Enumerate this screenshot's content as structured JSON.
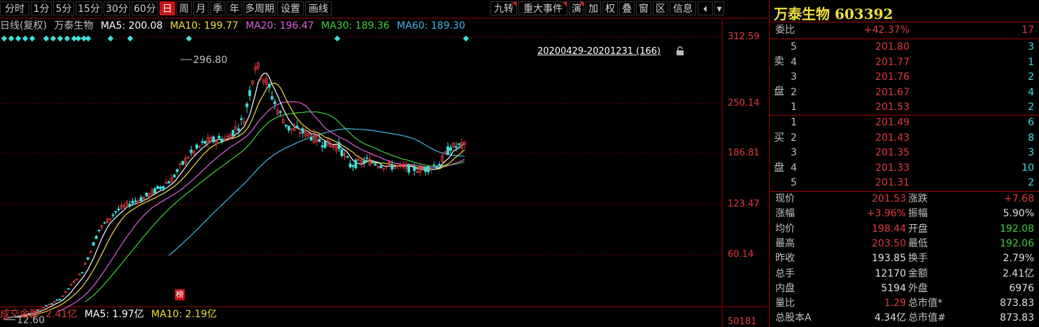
{
  "toolbar": {
    "tabs": [
      "分时",
      "1分",
      "5分",
      "15分",
      "30分",
      "60分",
      "日",
      "周",
      "月",
      "季",
      "年",
      "多周期",
      "设置",
      "画线"
    ],
    "active_tab": "日",
    "right_tabs": [
      "九转",
      "重大事件",
      "演",
      "加",
      "权",
      "叠",
      "窗",
      "区",
      "信息"
    ],
    "right_marked": [
      true,
      true,
      true,
      false,
      false,
      false,
      false,
      false,
      false
    ]
  },
  "chart_legend": {
    "label": "日线(复权)",
    "stock": "万泰生物",
    "ma5": "MA5: 200.08",
    "ma10": "MA10: 199.77",
    "ma20": "MA20: 196.47",
    "ma30": "MA30: 189.36",
    "ma60": "MA60: 189.30"
  },
  "colors": {
    "ma5": "#ffffff",
    "ma10": "#f0e040",
    "ma20": "#e060e0",
    "ma30": "#40d040",
    "ma60": "#40b8e8",
    "up": "#e03a3a",
    "down": "#40e0e0",
    "grid": "#7a0000"
  },
  "price_axis": [
    "312.59",
    "250.14",
    "186.81",
    "123.47",
    "60.14",
    "50181"
  ],
  "range_label": "20200429-20201231 (166)",
  "lock_icon": "lock-icon",
  "annotations": {
    "high": "296.80",
    "low": "12.60",
    "badge": "榜"
  },
  "volume_legend": {
    "amount": "成交金额: 2.41亿",
    "ma5": "MA5: 1.97亿",
    "ma10": "MA10: 2.19亿"
  },
  "chart_data": {
    "type": "candlestick",
    "y_range": [
      48,
      325
    ],
    "y_ticks": [
      312.59,
      250.14,
      186.81,
      123.47,
      60.14
    ],
    "high": 296.8,
    "low": 12.6,
    "grid": true,
    "ma_series": [
      {
        "name": "MA5",
        "value": 200.08
      },
      {
        "name": "MA10",
        "value": 199.77
      },
      {
        "name": "MA20",
        "value": 196.47
      },
      {
        "name": "MA30",
        "value": 189.36
      },
      {
        "name": "MA60",
        "value": 189.3
      }
    ]
  },
  "panel": {
    "title": "万泰生物 603392",
    "weibi": {
      "label": "委比",
      "value": "+42.37%",
      "vol": "17"
    },
    "sell_label": "卖盘",
    "buy_label": "买盘",
    "sell": [
      {
        "level": "5",
        "price": "201.80",
        "vol": "3"
      },
      {
        "level": "4",
        "price": "201.77",
        "vol": "1"
      },
      {
        "level": "3",
        "price": "201.76",
        "vol": "2"
      },
      {
        "level": "2",
        "price": "201.67",
        "vol": "4"
      },
      {
        "level": "1",
        "price": "201.53",
        "vol": "2"
      }
    ],
    "buy": [
      {
        "level": "1",
        "price": "201.49",
        "vol": "6"
      },
      {
        "level": "2",
        "price": "201.43",
        "vol": "8"
      },
      {
        "level": "3",
        "price": "201.35",
        "vol": "3"
      },
      {
        "level": "4",
        "price": "201.33",
        "vol": "10"
      },
      {
        "level": "5",
        "price": "201.31",
        "vol": "2"
      }
    ],
    "quotes": [
      {
        "l1": "现价",
        "v1": "201.53",
        "c1": "red",
        "l2": "涨跌",
        "v2": "+7.68",
        "c2": "red"
      },
      {
        "l1": "涨幅",
        "v1": "+3.96%",
        "c1": "red",
        "l2": "振幅",
        "v2": "5.90%",
        "c2": "white"
      },
      {
        "l1": "均价",
        "v1": "198.44",
        "c1": "red",
        "l2": "开盘",
        "v2": "192.08",
        "c2": "green"
      },
      {
        "l1": "最高",
        "v1": "203.50",
        "c1": "red",
        "l2": "最低",
        "v2": "192.06",
        "c2": "green"
      },
      {
        "l1": "昨收",
        "v1": "193.85",
        "c1": "white",
        "l2": "换手",
        "v2": "2.79%",
        "c2": "white"
      },
      {
        "l1": "总手",
        "v1": "12170",
        "c1": "white",
        "l2": "金额",
        "v2": "2.41亿",
        "c2": "white"
      },
      {
        "l1": "内盘",
        "v1": "5194",
        "c1": "white",
        "l2": "外盘",
        "v2": "6976",
        "c2": "white"
      },
      {
        "l1": "量比",
        "v1": "1.29",
        "c1": "red",
        "l2": "总市值*",
        "v2": "873.83",
        "c2": "white"
      },
      {
        "l1": "总股本A",
        "v1": "4.34亿",
        "c1": "white",
        "l2": "总市值#",
        "v2": "873.83",
        "c2": "white"
      }
    ]
  }
}
